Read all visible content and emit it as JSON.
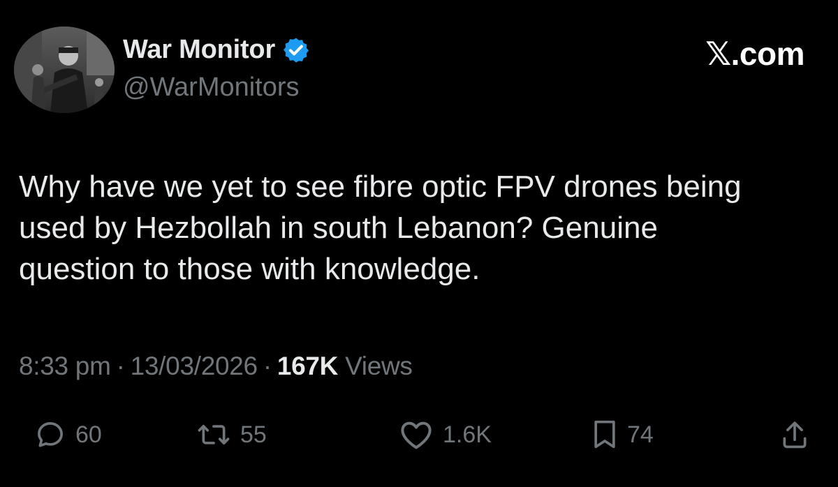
{
  "author": {
    "display_name": "War Monitor",
    "handle": "@WarMonitors",
    "verified": true,
    "avatar_icon": "profile-photo"
  },
  "brand": "𝕏.com",
  "tweet": {
    "text_lines": [
      "Why have we yet to see fibre optic FPV drones being",
      "used by Hezbollah in south Lebanon? Genuine",
      "question to those with knowledge."
    ]
  },
  "meta": {
    "time": "8:33 pm",
    "separator": "·",
    "date": "13/03/2026",
    "views_count": "167K",
    "views_label": "Views"
  },
  "actions": {
    "replies": "60",
    "reposts": "55",
    "likes": "1.6K",
    "bookmarks": "74"
  },
  "colors": {
    "background": "#000000",
    "primary_text": "#e7e9ea",
    "secondary_text": "#71767b",
    "verified_badge": "#1d9bf0"
  }
}
